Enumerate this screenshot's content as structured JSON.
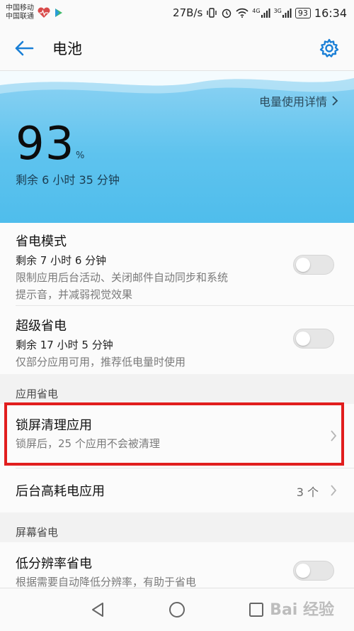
{
  "status_bar": {
    "carrier1": "中国移动",
    "carrier2": "中国联通",
    "speed": "27B/s",
    "net1": "4G",
    "net2": "3G",
    "battery": "93",
    "time": "16:34"
  },
  "app_bar": {
    "title": "电池"
  },
  "battery": {
    "detail_link": "电量使用详情",
    "percent": "93",
    "percent_unit": "%",
    "remaining": "剩余 6 小时 35 分钟",
    "level": 93
  },
  "power_saving": {
    "title": "省电模式",
    "sub": "剩余 7 小时 6 分钟",
    "desc_line1": "限制应用后台活动、关闭邮件自动同步和系统",
    "desc_line2": "提示音，并减弱视觉效果",
    "enabled": false
  },
  "ultra_saving": {
    "title": "超级省电",
    "sub": "剩余 17 小时 5 分钟",
    "desc": "仅部分应用可用，推荐低电量时使用",
    "enabled": false
  },
  "app_section": {
    "header": "应用省电"
  },
  "lockscreen_clean": {
    "title": "锁屏清理应用",
    "desc": "锁屏后，25 个应用不会被清理"
  },
  "background_apps": {
    "title": "后台高耗电应用",
    "count": "3 个"
  },
  "screen_section": {
    "header": "屏幕省电"
  },
  "low_resolution": {
    "title": "低分辨率省电",
    "desc": "根据需要自动降低分辨率，有助于省电",
    "enabled": false
  },
  "watermark": "Bai 经验",
  "colors": {
    "accent": "#1a7fd6",
    "battery_blue": "#5ec3ee",
    "highlight": "#e11e1e"
  }
}
